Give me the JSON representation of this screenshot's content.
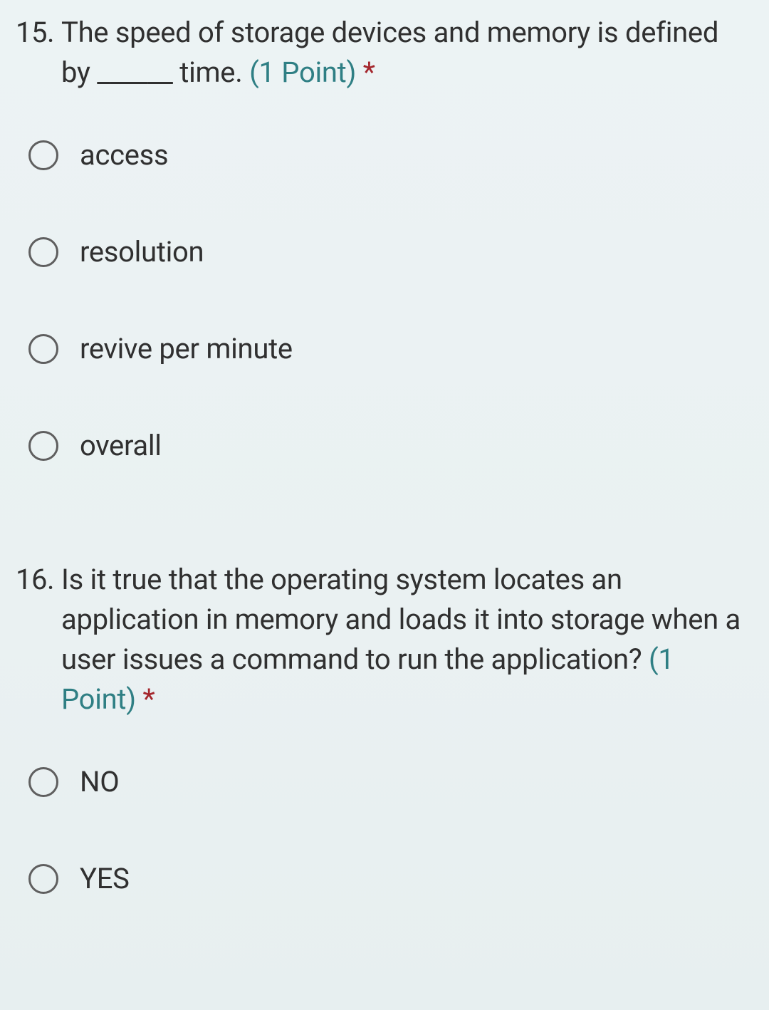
{
  "questions": [
    {
      "number": "15.",
      "text": "The speed of storage devices and memory is defined by ______ time.",
      "points": "(1 Point)",
      "required": "*",
      "options": [
        {
          "label": "access"
        },
        {
          "label": "resolution"
        },
        {
          "label": "revive per minute"
        },
        {
          "label": "overall"
        }
      ]
    },
    {
      "number": "16.",
      "text": "Is it true that the operating system locates an application in memory and loads it into storage when a user issues a command to run the application?",
      "points": "(1 Point)",
      "required": "*",
      "options": [
        {
          "label": "NO"
        },
        {
          "label": "YES"
        }
      ]
    }
  ]
}
